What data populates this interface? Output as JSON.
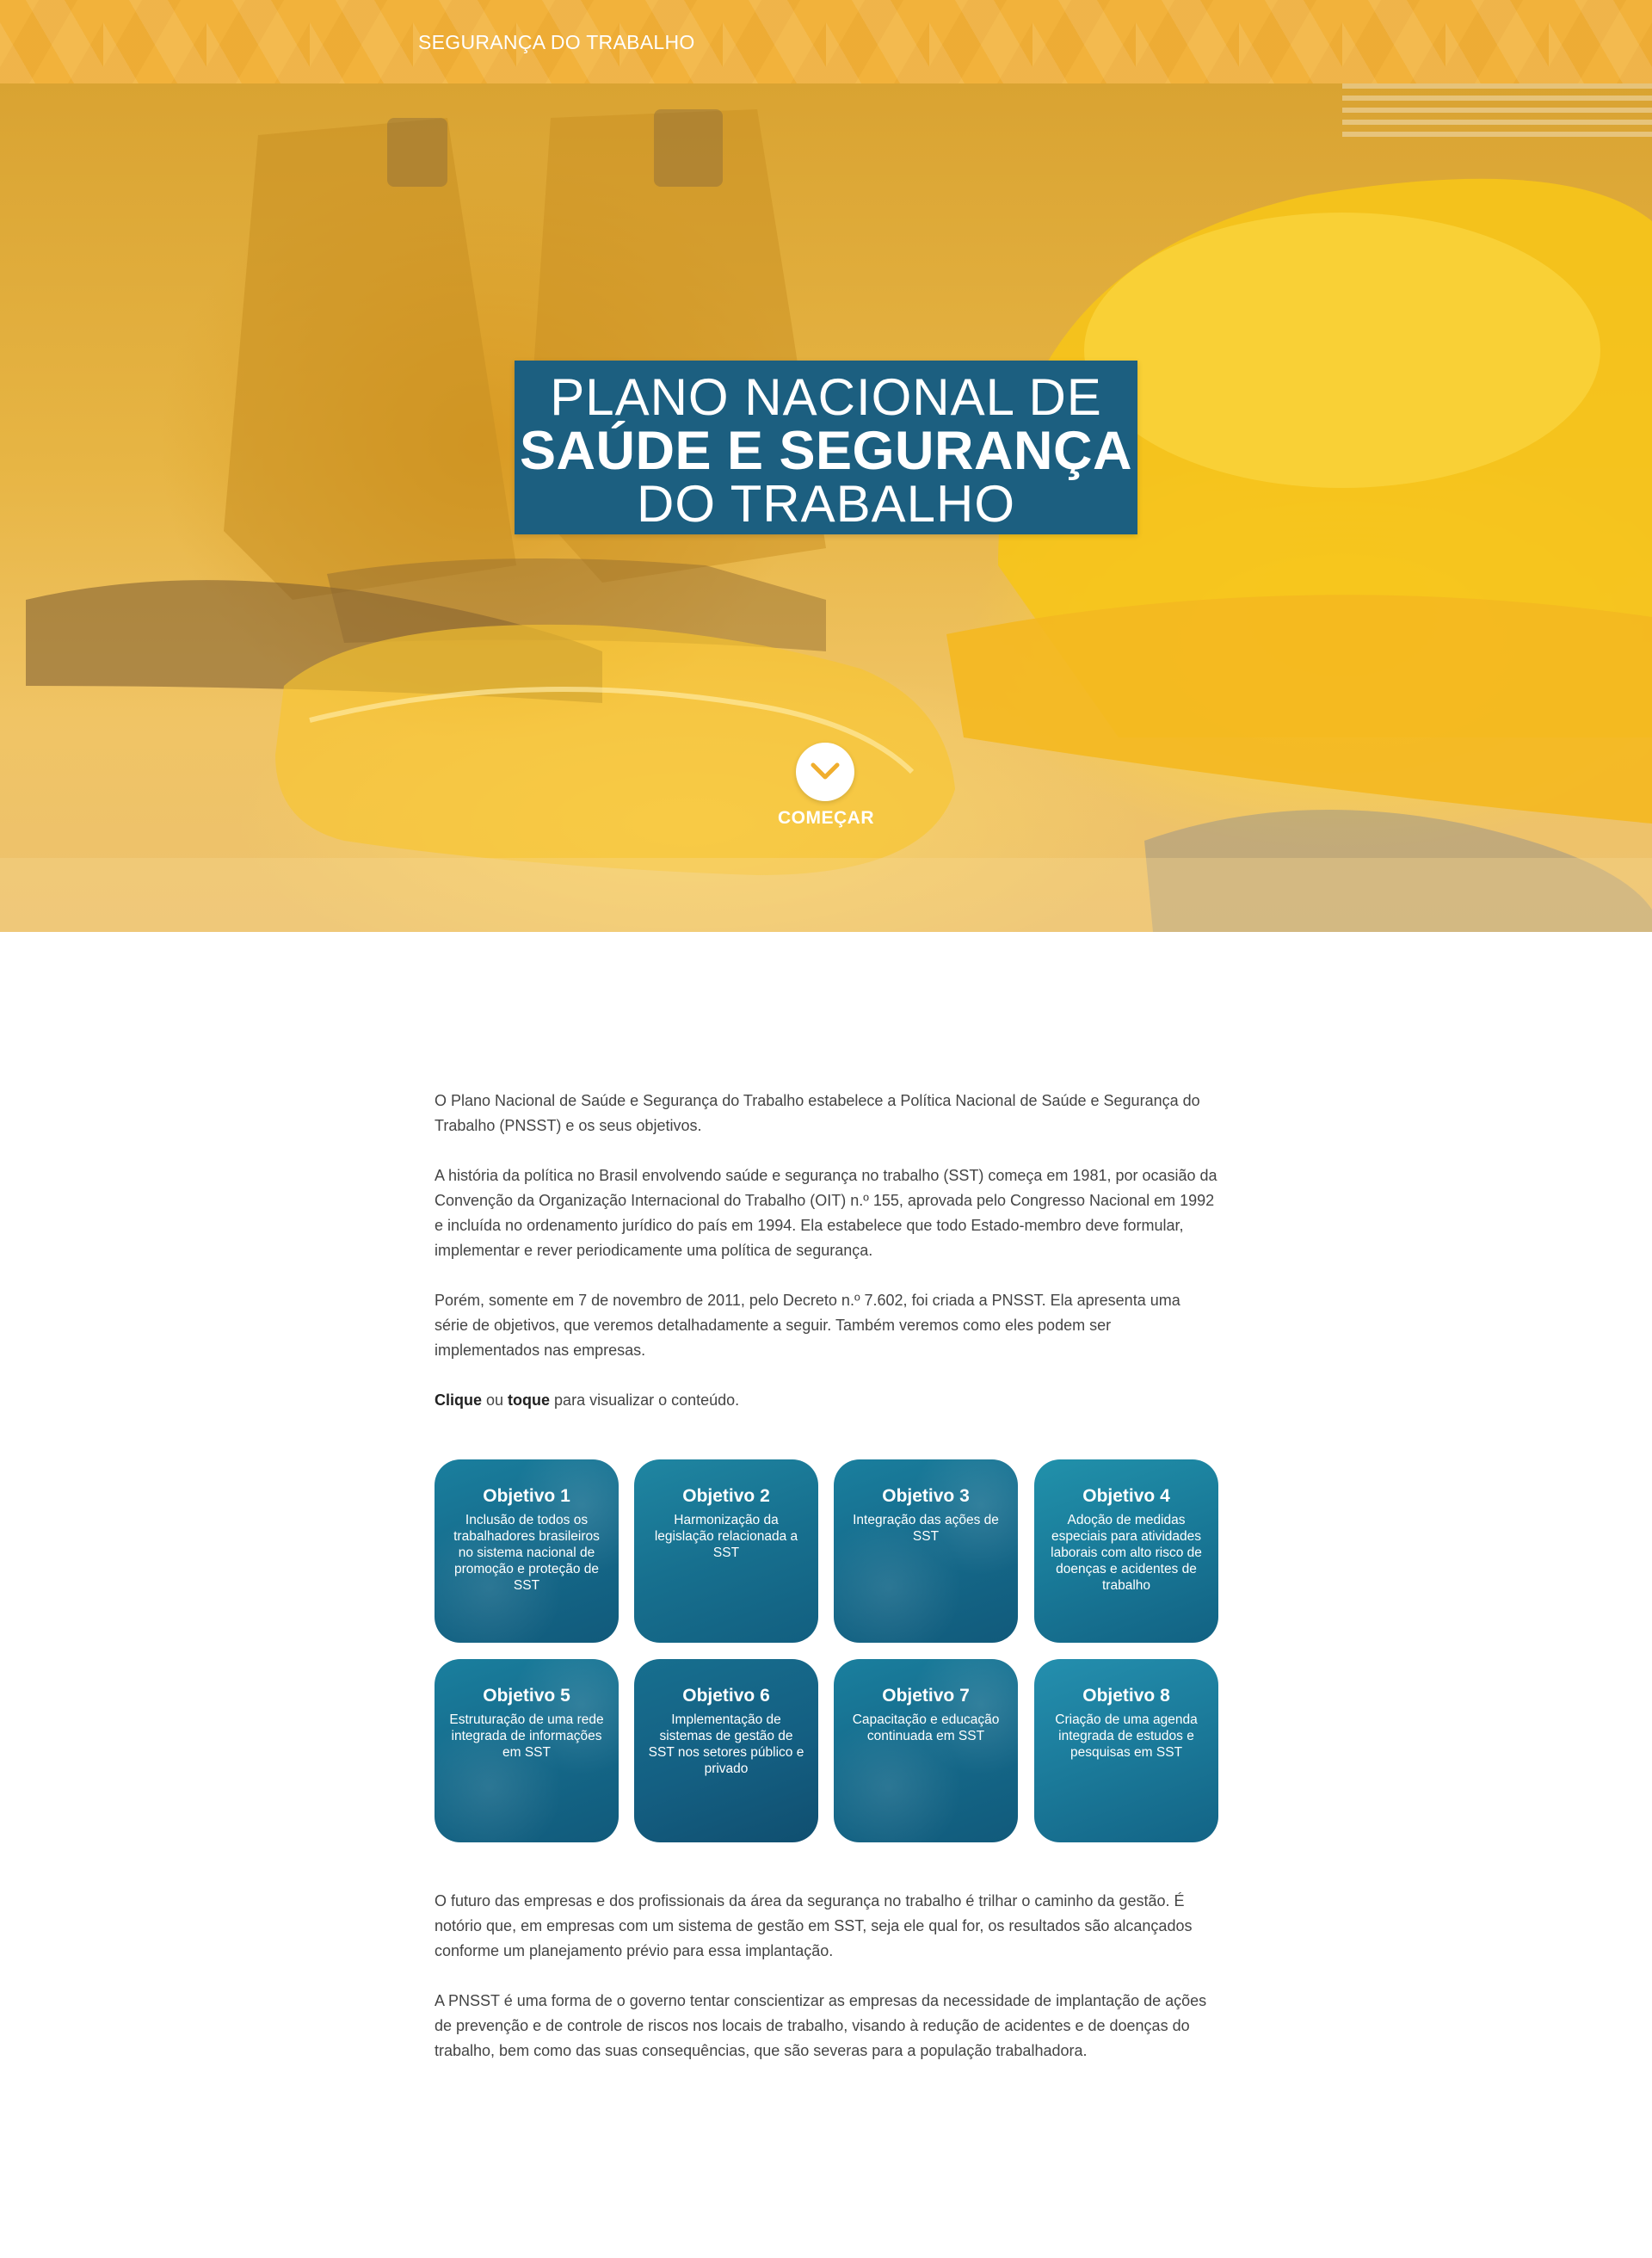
{
  "topbar": {
    "title": "SEGURANÇA DO TRABALHO"
  },
  "hero": {
    "line1": "PLANO NACIONAL DE",
    "line2": "SAÚDE E SEGURANÇA",
    "line3": "DO TRABALHO",
    "start_label": "COMEÇAR",
    "start_icon": "chevron-down-icon"
  },
  "intro": {
    "p1": "O Plano Nacional de Saúde e Segurança do Trabalho estabelece a Política Nacional de Saúde e Segurança do Trabalho (PNSST) e os seus objetivos.",
    "p2": "A história da política no Brasil envolvendo saúde e segurança no trabalho (SST) começa em 1981, por ocasião da Convenção da Organização Internacional do Trabalho (OIT) n.º 155, aprovada pelo Congresso Nacional em 1992 e incluída no ordenamento jurídico do país em 1994. Ela estabelece que todo Estado-membro deve formular, implementar e rever periodicamente uma política de segurança.",
    "p3": "Porém, somente em 7 de novembro de 2011, pelo Decreto n.º 7.602, foi criada a PNSST. Ela apresenta uma série de objetivos, que veremos detalhadamente a seguir. Também veremos como eles podem ser implementados nas empresas.",
    "hint_word1": "Clique",
    "hint_mid": " ou ",
    "hint_word2": "toque",
    "hint_rest": " para visualizar o conteúdo."
  },
  "objectives": [
    {
      "title": "Objetivo 1",
      "desc": "Inclusão de todos os trabalhadores brasileiros no sistema nacional de promoção e proteção de SST"
    },
    {
      "title": "Objetivo 2",
      "desc": "Harmonização da legislação relacionada a SST"
    },
    {
      "title": "Objetivo 3",
      "desc": "Integração das ações de SST"
    },
    {
      "title": "Objetivo 4",
      "desc": "Adoção de medidas especiais para atividades laborais com alto risco de doenças e acidentes de trabalho"
    },
    {
      "title": "Objetivo 5",
      "desc": "Estruturação de uma rede integrada de informações em SST"
    },
    {
      "title": "Objetivo 6",
      "desc": "Implementação de sistemas de gestão de SST nos setores público e privado"
    },
    {
      "title": "Objetivo 7",
      "desc": "Capacitação e educação continuada em SST"
    },
    {
      "title": "Objetivo 8",
      "desc": "Criação de uma agenda integrada de estudos e pesquisas em SST"
    }
  ],
  "outro": {
    "p1": "O futuro das empresas e dos profissionais da área da segurança no trabalho é trilhar o caminho da gestão. É notório que, em empresas com um sistema de gestão em SST, seja ele qual for, os resultados são alcançados conforme um planejamento prévio para essa implantação.",
    "p2": "A PNSST é uma forma de o governo tentar conscientizar as empresas da necessidade de implantação de ações de prevenção e de controle de riscos nos locais de trabalho, visando à redução de acidentes e de doenças do trabalho, bem como das suas consequências, que são severas para a população trabalhadora."
  },
  "colors": {
    "topbar": "#f2b23b",
    "title_box": "#1c5f80",
    "card": "#156a8b",
    "text": "#444444"
  }
}
